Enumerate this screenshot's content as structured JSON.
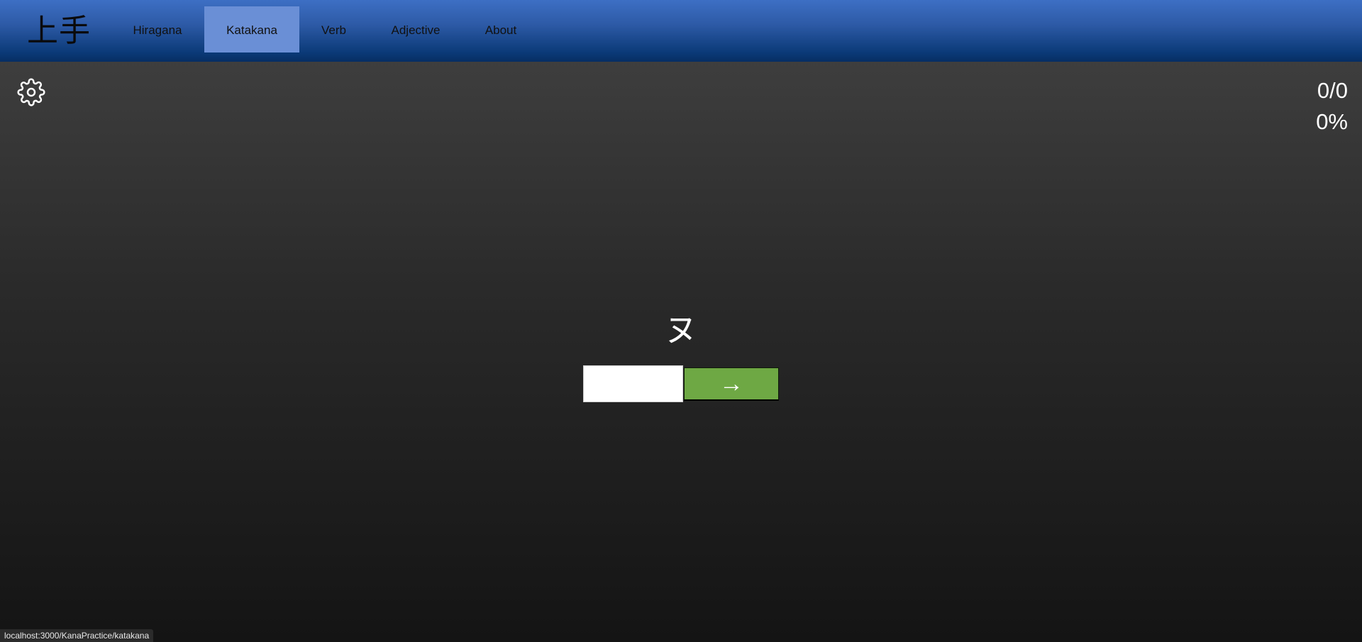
{
  "navbar": {
    "brand": "上手",
    "items": [
      {
        "label": "Hiragana",
        "active": false
      },
      {
        "label": "Katakana",
        "active": true
      },
      {
        "label": "Verb",
        "active": false
      },
      {
        "label": "Adjective",
        "active": false
      },
      {
        "label": "About",
        "active": false
      }
    ],
    "active_color": "#6a8fd6"
  },
  "settings": {
    "icon": "gear-icon"
  },
  "score": {
    "count": "0/0",
    "percent": "0%"
  },
  "quiz": {
    "kana": "ヌ",
    "answer_value": "",
    "submit_label": "→",
    "submit_color": "#6ea844"
  },
  "status_bar": {
    "url": "localhost:3000/KanaPractice/katakana"
  }
}
